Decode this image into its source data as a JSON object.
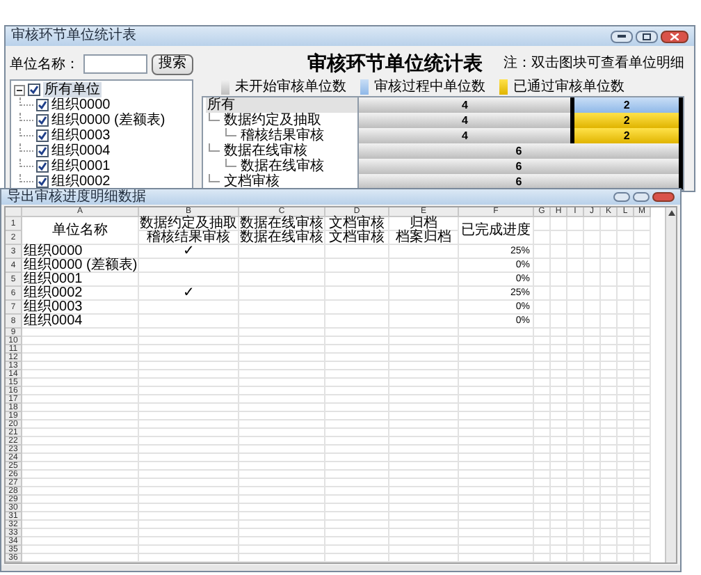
{
  "main_window": {
    "title": "审核环节单位统计表",
    "search": {
      "label": "单位名称：",
      "button": "搜索"
    },
    "heading": "审核环节单位统计表",
    "note": "注：双击图块可查看单位明细",
    "legend": [
      {
        "kind": "not_started",
        "label": "未开始审核单位数"
      },
      {
        "kind": "in_progress",
        "label": "审核过程中单位数"
      },
      {
        "kind": "passed",
        "label": "已通过审核单位数"
      }
    ],
    "unit_tree": {
      "label": "所有单位",
      "checked": true,
      "expanded": true,
      "selected": true,
      "children": [
        {
          "label": "组织0000",
          "checked": true
        },
        {
          "label": "组织0000 (差额表)",
          "checked": true
        },
        {
          "label": "组织0003",
          "checked": true
        },
        {
          "label": "组织0004",
          "checked": true
        },
        {
          "label": "组织0001",
          "checked": true
        },
        {
          "label": "组织0002",
          "checked": true
        }
      ]
    },
    "stage_tree": {
      "label": "所有",
      "selected": true,
      "children": [
        {
          "label": "数据约定及抽取",
          "selected": false,
          "children": [
            {
              "label": "稽核结果审核",
              "selected": false
            }
          ]
        },
        {
          "label": "数据在线审核",
          "selected": false,
          "children": [
            {
              "label": "数据在线审核",
              "selected": false
            }
          ]
        },
        {
          "label": "文档审核",
          "selected": false
        }
      ]
    },
    "bars": [
      {
        "segments": [
          {
            "kind": "not_started",
            "value": "4"
          },
          {
            "kind": "in_progress",
            "value": "2"
          }
        ]
      },
      {
        "segments": [
          {
            "kind": "not_started",
            "value": "4"
          },
          {
            "kind": "passed",
            "value": "2"
          }
        ]
      },
      {
        "segments": [
          {
            "kind": "not_started",
            "value": "4"
          },
          {
            "kind": "passed",
            "value": "2"
          }
        ]
      },
      {
        "segments": [
          {
            "kind": "not_started",
            "value": "6"
          }
        ]
      },
      {
        "segments": [
          {
            "kind": "not_started",
            "value": "6"
          }
        ]
      },
      {
        "segments": [
          {
            "kind": "not_started",
            "value": "6"
          }
        ]
      }
    ]
  },
  "export_window": {
    "title": "导出审核进度明细数据",
    "columns": [
      "A",
      "B",
      "C",
      "D",
      "E",
      "F",
      "G",
      "H",
      "I",
      "J",
      "K",
      "L",
      "M"
    ],
    "rows": [
      {
        "number": "1",
        "cells": {
          "A": {
            "text": "单位名称",
            "merged_down": true
          },
          "B": "数据约定及抽取",
          "C": "数据在线审核",
          "D": "文档审核",
          "E": "归档",
          "F": {
            "text": "已完成进度",
            "merged_down": true
          }
        }
      },
      {
        "number": "2",
        "cells": {
          "B": "稽核结果审核",
          "C": "数据在线审核",
          "D": "文档审核",
          "E": "档案归档"
        }
      },
      {
        "number": "3",
        "cells": {
          "A": "组织0000",
          "B": "✓",
          "F": "25%"
        }
      },
      {
        "number": "4",
        "cells": {
          "A": "组织0000 (差额表)",
          "F": "0%"
        }
      },
      {
        "number": "5",
        "cells": {
          "A": "组织0001",
          "F": "0%"
        }
      },
      {
        "number": "6",
        "cells": {
          "A": "组织0002",
          "B": "✓",
          "F": "25%"
        }
      },
      {
        "number": "7",
        "cells": {
          "A": "组织0003",
          "F": "0%"
        }
      },
      {
        "number": "8",
        "cells": {
          "A": "组织0004",
          "F": "0%"
        }
      },
      {
        "number": "9"
      },
      {
        "number": "10"
      },
      {
        "number": "11"
      },
      {
        "number": "12"
      },
      {
        "number": "13"
      },
      {
        "number": "14"
      },
      {
        "number": "15"
      },
      {
        "number": "16"
      },
      {
        "number": "17"
      },
      {
        "number": "18"
      },
      {
        "number": "19"
      },
      {
        "number": "20"
      },
      {
        "number": "21"
      },
      {
        "number": "22"
      },
      {
        "number": "23"
      },
      {
        "number": "24"
      },
      {
        "number": "25"
      },
      {
        "number": "26"
      },
      {
        "number": "27"
      },
      {
        "number": "28"
      },
      {
        "number": "29"
      },
      {
        "number": "30"
      },
      {
        "number": "31"
      },
      {
        "number": "32"
      },
      {
        "number": "33"
      },
      {
        "number": "34"
      },
      {
        "number": "35"
      },
      {
        "number": "36"
      }
    ]
  }
}
